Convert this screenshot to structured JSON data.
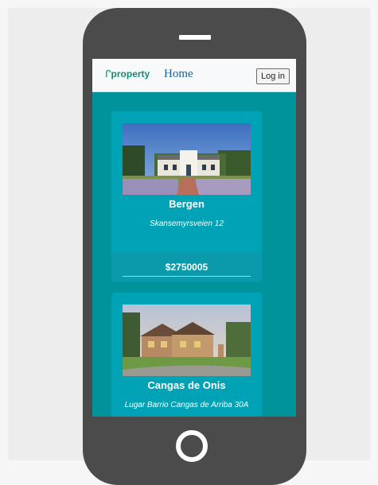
{
  "navbar": {
    "brand": "property",
    "brand_icon": "property-logo-icon",
    "home_link": "Home",
    "login_label": "Log in"
  },
  "listings": [
    {
      "city": "Bergen",
      "address": "Skansemyrsveien 12",
      "price": "$2750005",
      "image": "white-farmhouse-photo"
    },
    {
      "city": "Cangas de Onis",
      "address": "Lugar Barrio Cangas de Arriba 30A",
      "image": "stone-house-photo"
    }
  ],
  "colors": {
    "screen_bg": "#00939b",
    "card_bg": "#00a3b5",
    "phone_body": "#4b4b4b",
    "brand": "#1a8a78"
  }
}
